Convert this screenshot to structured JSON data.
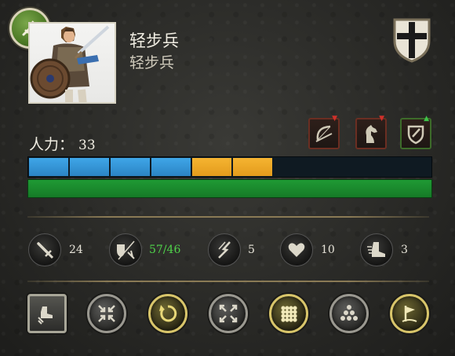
{
  "unit": {
    "name": "轻步兵",
    "subtitle": "轻步兵",
    "class_icon": "infantry-sword-icon",
    "faction_icon": "cross-shield-icon"
  },
  "manpower": {
    "label": "人力：",
    "value": "33"
  },
  "modifiers": [
    {
      "icon": "bow-icon",
      "direction": "down"
    },
    {
      "icon": "horse-icon",
      "direction": "down"
    },
    {
      "icon": "shield-icon",
      "direction": "up"
    }
  ],
  "strength_bar": {
    "segments_filled_blue": 4,
    "segments_filled_gold": 2,
    "total_segments": 10,
    "health_fraction": 1.0
  },
  "stats": {
    "attack": "24",
    "defense_current": "57",
    "defense_separator": "/",
    "defense_max": "46",
    "charge": "5",
    "morale": "10",
    "speed": "3"
  },
  "colors": {
    "blue_segment": "#3fa6e8",
    "gold_segment": "#f5b431",
    "health": "#1f9a34",
    "stat_highlight": "#4fd34a"
  }
}
